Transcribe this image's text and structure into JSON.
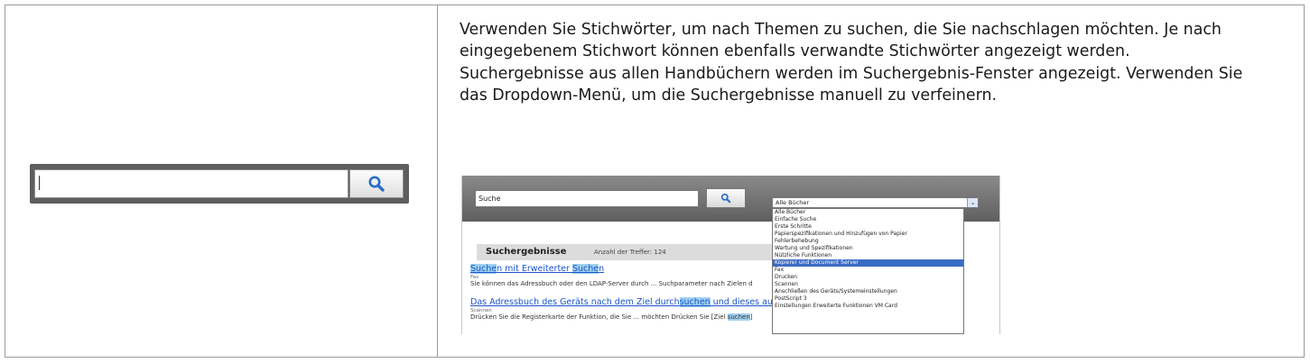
{
  "description": {
    "paragraphs": [
      "Verwenden Sie Stichwörter, um nach Themen zu suchen, die Sie nachschlagen möchten. Je nach eingegebenem Stichwort können ebenfalls verwandte Stichwörter angezeigt werden.",
      "Suchergebnisse aus allen Handbüchern werden im Suchergebnis-Fenster angezeigt. Verwenden Sie das Dropdown-Menü, um die Suchergebnisse manuell zu verfeinern."
    ]
  },
  "search_widget": {
    "value": "",
    "button_icon": "search-icon"
  },
  "screenshot": {
    "search_value": "Suche",
    "select_value": "Alle Bücher",
    "results_title": "Suchergebnisse",
    "results_count": "Anzahl der Treffer:  124",
    "results": [
      {
        "link_parts": [
          "Suche",
          "n mit Erweiterter ",
          "Suche",
          "n"
        ],
        "category": "Fax",
        "snippet": "Sie können das Adressbuch oder den LDAP-Server durch ... Suchparameter nach Zielen d"
      },
      {
        "link_parts": [
          "Das Adressbuch des Geräts nach dem Ziel durch",
          "suchen",
          " und dieses auswä"
        ],
        "category": "Scannen",
        "snippet_parts": [
          "Drücken Sie die Registerkarte der Funktion, die Sie ... möchten Drücken Sie [Ziel ",
          "suchen",
          "]"
        ]
      }
    ],
    "dropdown_items": [
      "Alle Bücher",
      "Einfache Suche",
      "Erste Schritte",
      "Papierspezifikationen und Hinzufügen von Papier",
      "Fehlerbehebung",
      "Wartung und Spezifikationen",
      "Nützliche Funktionen",
      "Kopierer und Document Server",
      "Fax",
      "Drucken",
      "Scannen",
      "Anschließen des Geräts/Systemeinstellungen",
      "PostScript 3",
      "Einstellungen Erweiterte Funktionen VM Card"
    ],
    "selected_index": 7,
    "accent_color": "#3a6bc4",
    "link_color": "#1a55c8",
    "highlight_color": "#9fd0f0"
  }
}
